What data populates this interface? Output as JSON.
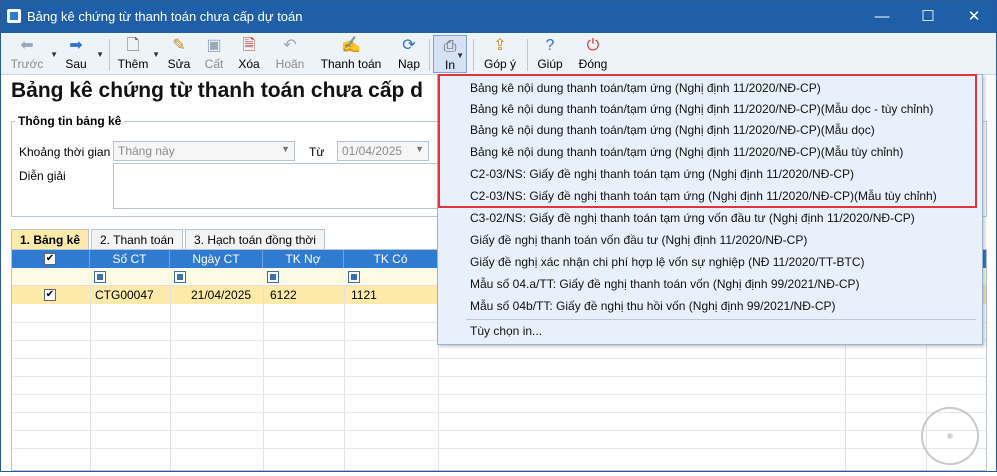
{
  "window": {
    "title": "Bảng kê chứng từ thanh toán chưa cấp dự toán"
  },
  "toolbar": {
    "prev": "Trước",
    "next": "Sau",
    "add": "Thêm",
    "edit": "Sửa",
    "save": "Cất",
    "delete": "Xóa",
    "undo": "Hoãn",
    "pay": "Thanh toán",
    "reload": "Nạp",
    "print": "In",
    "feedback": "Góp ý",
    "help": "Giúp",
    "close": "Đóng"
  },
  "page": {
    "title": "Bảng kê chứng từ thanh toán chưa cấp d"
  },
  "info": {
    "legend": "Thông tin bảng kê",
    "period_label": "Khoảng thời gian",
    "period_value": "Tháng này",
    "from_label": "Từ",
    "from_value": "01/04/2025",
    "desc_label": "Diễn giải"
  },
  "tabs": [
    "1. Bảng kê",
    "2. Thanh toán",
    "3. Hạch toán đồng thời"
  ],
  "grid": {
    "columns": [
      "Số CT",
      "Ngày CT",
      "TK Nợ",
      "TK Có"
    ],
    "rows": [
      {
        "checked": true,
        "so_ct": "CTG00047",
        "ngay_ct": "21/04/2025",
        "tk_no": "6122",
        "tk_co": "1121"
      }
    ]
  },
  "print_menu": {
    "items": [
      "Bảng kê nội dung thanh toán/tạm ứng (Nghị định 11/2020/NĐ-CP)",
      "Bảng kê nội dung thanh toán/tạm ứng (Nghị định 11/2020/NĐ-CP)(Mẫu dọc - tùy chỉnh)",
      "Bảng kê nội dung thanh toán/tạm ứng (Nghị định 11/2020/NĐ-CP)(Mẫu dọc)",
      "Bảng kê nội dung thanh toán/tạm ứng (Nghị định 11/2020/NĐ-CP)(Mẫu tùy chỉnh)",
      "C2-03/NS: Giấy đề nghị thanh toán tạm ứng (Nghị định 11/2020/NĐ-CP)",
      "C2-03/NS: Giấy đề nghị thanh toán tạm ứng (Nghị định 11/2020/NĐ-CP)(Mẫu tùy chỉnh)",
      "C3-02/NS: Giấy đề nghị thanh toán tạm ứng vốn đầu tư (Nghị định 11/2020/NĐ-CP)",
      "Giấy đề nghị thanh toán vốn đầu tư (Nghị định 11/2020/NĐ-CP)",
      "Giấy đề nghị xác nhận chi phí hợp lệ vốn sự nghiệp (NĐ 11/2020/TT-BTC)",
      "Mẫu số 04.a/TT: Giấy đề nghị thanh toán vốn (Nghị định 99/2021/NĐ-CP)",
      "Mẫu số 04b/TT: Giấy đề nghị thu hồi vốn (Nghị định 99/2021/NĐ-CP)"
    ],
    "options": "Tùy chọn in..."
  },
  "colors": {
    "titlebar": "#1e5fa8",
    "grid_header": "#2f7bd2",
    "selected_row": "#fde9a8",
    "highlight": "#e0353b"
  }
}
